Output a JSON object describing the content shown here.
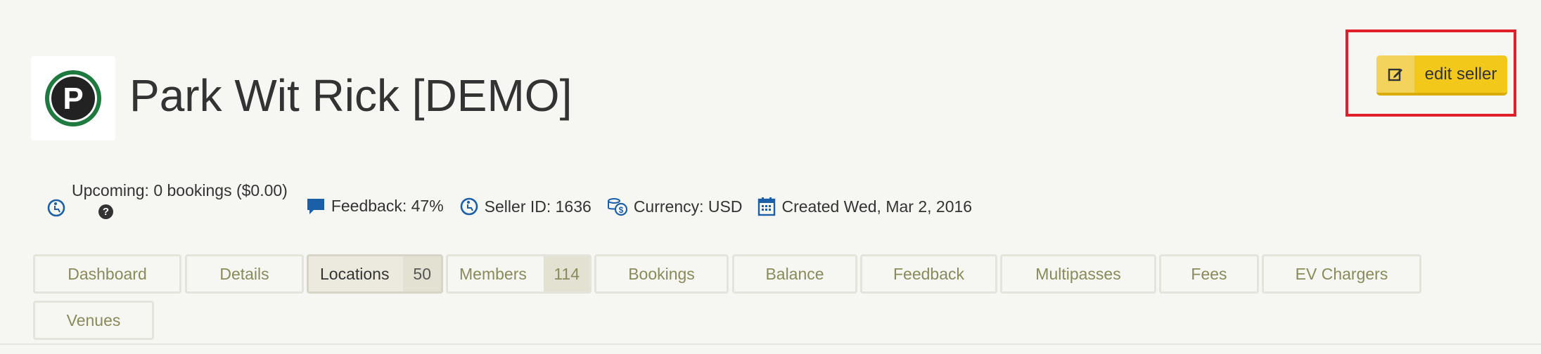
{
  "seller": {
    "title": "Park Wit Rick [DEMO]",
    "logo_letter": "P"
  },
  "actions": {
    "edit_label": "edit seller"
  },
  "meta": {
    "upcoming": "Upcoming: 0 bookings ($0.00)",
    "help_glyph": "?",
    "feedback": "Feedback: 47%",
    "seller_id": "Seller ID: 1636",
    "currency": "Currency: USD",
    "created": "Created Wed, Mar 2, 2016"
  },
  "tabs": [
    {
      "label": "Dashboard"
    },
    {
      "label": "Details"
    },
    {
      "label": "Locations",
      "count": "50",
      "active": true
    },
    {
      "label": "Members",
      "count": "114"
    },
    {
      "label": "Bookings"
    },
    {
      "label": "Balance"
    },
    {
      "label": "Feedback"
    },
    {
      "label": "Multipasses"
    },
    {
      "label": "Fees"
    },
    {
      "label": "EV Chargers"
    },
    {
      "label": "Venues"
    }
  ],
  "colors": {
    "accent_yellow": "#f2c81b",
    "icon_blue": "#1a5fa8",
    "highlight_red": "#e0202a",
    "logo_green": "#1e7a3e"
  }
}
